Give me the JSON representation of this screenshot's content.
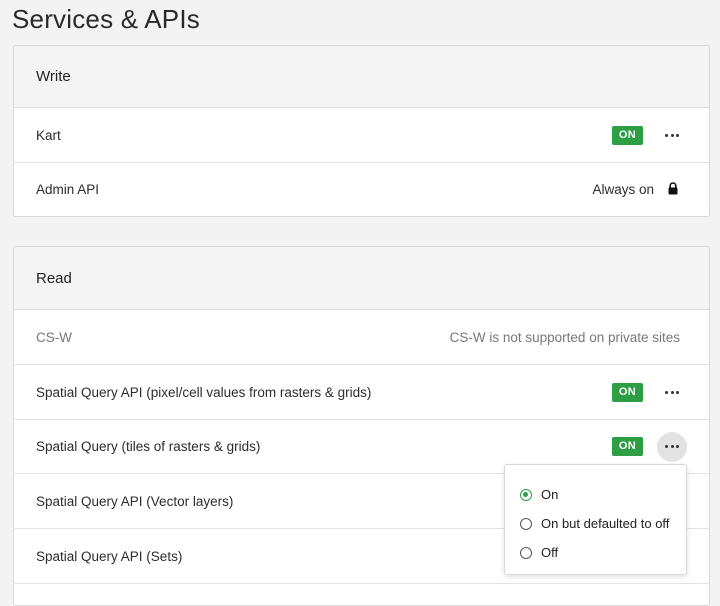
{
  "page": {
    "title": "Services & APIs"
  },
  "write": {
    "title": "Write",
    "rows": [
      {
        "label": "Kart",
        "status": "ON"
      },
      {
        "label": "Admin API",
        "status": "Always on"
      }
    ]
  },
  "read": {
    "title": "Read",
    "rows": [
      {
        "label": "CS-W",
        "note": "CS-W is not supported on private sites"
      },
      {
        "label": "Spatial Query API (pixel/cell values from rasters & grids)",
        "status": "ON"
      },
      {
        "label": "Spatial Query (tiles of rasters & grids)",
        "status": "ON"
      },
      {
        "label": "Spatial Query API (Vector layers)"
      },
      {
        "label": "Spatial Query API (Sets)"
      }
    ]
  },
  "dropdown": {
    "options": [
      {
        "label": "On",
        "selected": true
      },
      {
        "label": "On but defaulted to off",
        "selected": false
      },
      {
        "label": "Off",
        "selected": false
      }
    ]
  },
  "colors": {
    "accent": "#2e9e44",
    "header_bg": "#f4f4f4",
    "page_bg": "#f3f3f3"
  },
  "icons": {
    "more": "more-horizontal-icon",
    "lock": "lock-icon"
  }
}
